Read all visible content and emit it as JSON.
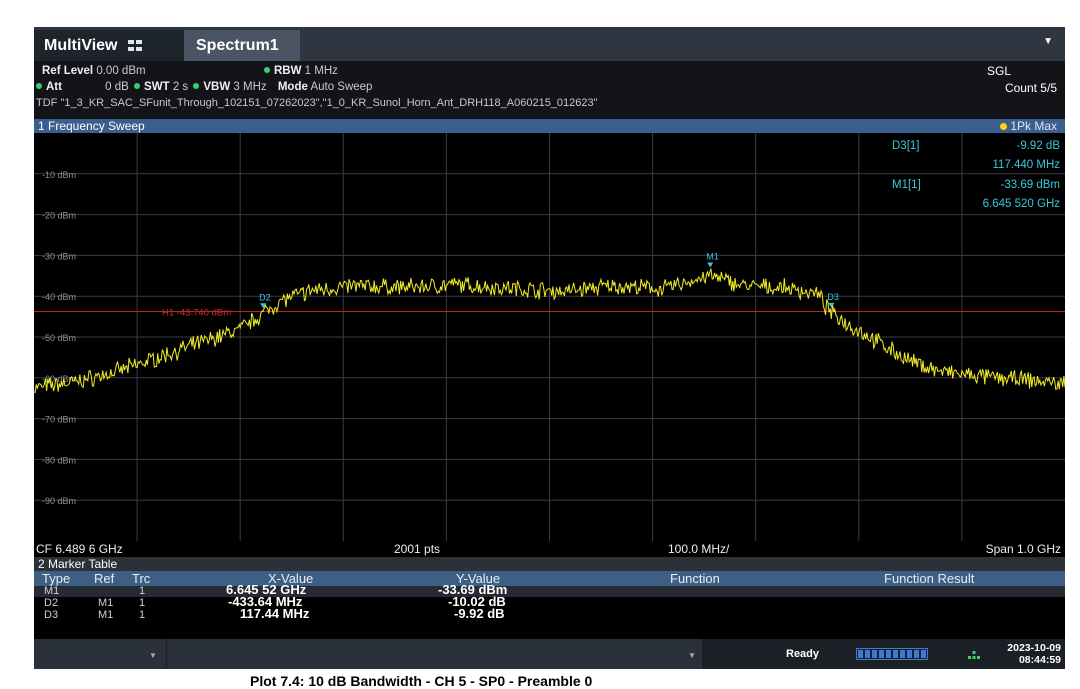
{
  "tabs": {
    "multiview": "MultiView",
    "spectrum": "Spectrum1"
  },
  "info": {
    "ref_level_label": "Ref Level",
    "ref_level_value": "0.00 dBm",
    "rbw_label": "RBW",
    "rbw_value": "1 MHz",
    "att_label": "Att",
    "att_value": "0 dB",
    "swt_label": "SWT",
    "swt_value": "2 s",
    "vbw_label": "VBW",
    "vbw_value": "3 MHz",
    "mode_label": "Mode",
    "mode_value": "Auto Sweep",
    "tdf": "TDF \"1_3_KR_SAC_SFunit_Through_102151_07262023\",\"1_0_KR_Sunol_Horn_Ant_DRH118_A060215_012623\"",
    "sgl": "SGL",
    "count": "Count 5/5"
  },
  "sweep": {
    "title": "1 Frequency Sweep",
    "trace_mode": "1Pk Max"
  },
  "marker_readout": {
    "d3_label": "D3[1]",
    "d3_value": "-9.92 dB",
    "d3_freq": "117.440 MHz",
    "m1_label": "M1[1]",
    "m1_value": "-33.69 dBm",
    "m1_freq": "6.645 520 GHz"
  },
  "chart_data": {
    "type": "line",
    "ylim": [
      -100,
      0
    ],
    "xlim": [
      5.9896,
      6.9896
    ],
    "y_ticks": [
      "-10 dBm",
      "-20 dBm",
      "-30 dBm",
      "-40 dBm",
      "-50 dBm",
      "-60 dBm",
      "-70 dBm",
      "-80 dBm",
      "-90 dBm"
    ],
    "threshold": {
      "label": "H1 -43.740 dBm",
      "value": -43.74
    },
    "markers": [
      {
        "label": "M1",
        "x": 6.64552,
        "y": -33.69
      },
      {
        "label": "D2",
        "x": 6.21188,
        "y": -43.7
      },
      {
        "label": "D3",
        "x": 6.76296,
        "y": -43.6
      }
    ],
    "trace": {
      "x": [
        5.9896,
        6.03,
        6.07,
        6.11,
        6.15,
        6.19,
        6.21,
        6.23,
        6.26,
        6.3,
        6.35,
        6.4,
        6.45,
        6.5,
        6.55,
        6.6,
        6.645,
        6.68,
        6.72,
        6.75,
        6.76,
        6.78,
        6.81,
        6.84,
        6.87,
        6.9,
        6.95,
        6.9896
      ],
      "y": [
        -62.5,
        -61,
        -58.5,
        -55,
        -51.5,
        -48,
        -44.5,
        -41,
        -38.5,
        -37.5,
        -37.8,
        -37.2,
        -38,
        -38.8,
        -37.5,
        -38.2,
        -35,
        -37.5,
        -38,
        -39.5,
        -43.5,
        -47,
        -51.5,
        -56,
        -58.5,
        -59.5,
        -60.5,
        -61.5
      ]
    }
  },
  "bottom_axis": {
    "cf": "CF 6.489 6 GHz",
    "pts": "2001 pts",
    "div": "100.0 MHz/",
    "span": "Span 1.0 GHz"
  },
  "marker_table": {
    "title": "2 Marker Table",
    "headers": {
      "type": "Type",
      "ref": "Ref",
      "trc": "Trc",
      "x": "X-Value",
      "y": "Y-Value",
      "function": "Function",
      "result": "Function Result"
    },
    "rows": [
      {
        "type": "M1",
        "ref": "",
        "trc": "1",
        "x": "6.645 52 GHz",
        "y": "-33.69 dBm"
      },
      {
        "type": "D2",
        "ref": "M1",
        "trc": "1",
        "x": "-433.64 MHz",
        "y": "-10.02 dB"
      },
      {
        "type": "D3",
        "ref": "M1",
        "trc": "1",
        "x": "117.44 MHz",
        "y": "-9.92 dB"
      }
    ]
  },
  "status": {
    "ready": "Ready",
    "date": "2023-10-09",
    "time": "08:44:59"
  },
  "caption": "Plot 7.4: 10 dB Bandwidth - CH 5 - SP0 - Preamble 0",
  "colors": {
    "trace": "#f2ec27",
    "threshold": "#c81e1e",
    "marker": "#36c9dc",
    "grid": "#3a3d44"
  }
}
